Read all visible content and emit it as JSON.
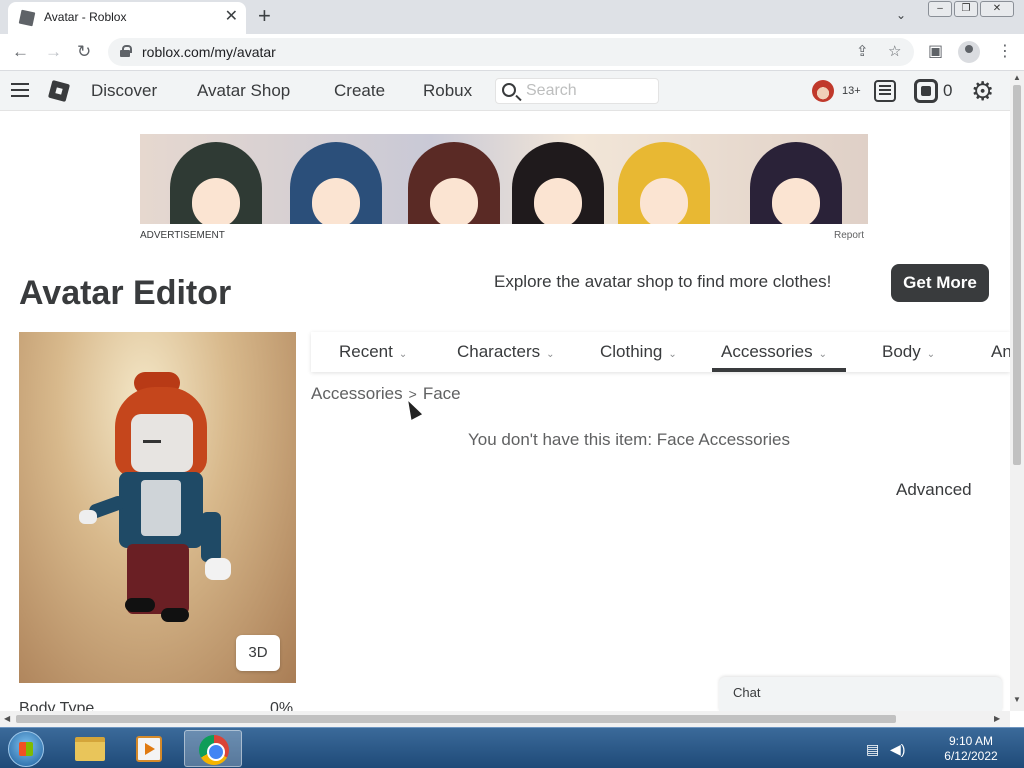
{
  "browser": {
    "tab_title": "Avatar - Roblox",
    "url": "roblox.com/my/avatar",
    "new_tab_icon": "plus-icon",
    "close_tab_icon": "close-icon"
  },
  "header": {
    "nav": [
      "Discover",
      "Avatar Shop",
      "Create",
      "Robux"
    ],
    "search_placeholder": "Search",
    "age_badge": "13+",
    "robux_count": "0"
  },
  "ad": {
    "label": "ADVERTISEMENT",
    "report": "Report"
  },
  "page": {
    "title": "Avatar Editor",
    "explore_text": "Explore the avatar shop to find more clothes!",
    "get_more_label": "Get More"
  },
  "avatar_panel": {
    "view_toggle": "3D",
    "body_type_label": "Body Type",
    "body_type_value": "0%"
  },
  "category_tabs": {
    "items": [
      "Recent",
      "Characters",
      "Clothing",
      "Accessories",
      "Body",
      "An"
    ],
    "selected": "Accessories"
  },
  "breadcrumb": {
    "parent": "Accessories",
    "separator": ">",
    "current": "Face"
  },
  "content": {
    "empty_message": "You don't have this item: Face Accessories",
    "advanced_label": "Advanced"
  },
  "chat": {
    "label": "Chat"
  },
  "taskbar": {
    "time": "9:10 AM",
    "date": "6/12/2022"
  },
  "colors": {
    "text_primary": "#393b3d",
    "button_dark": "#393b3d",
    "header_bg": "#f2f4f5"
  }
}
